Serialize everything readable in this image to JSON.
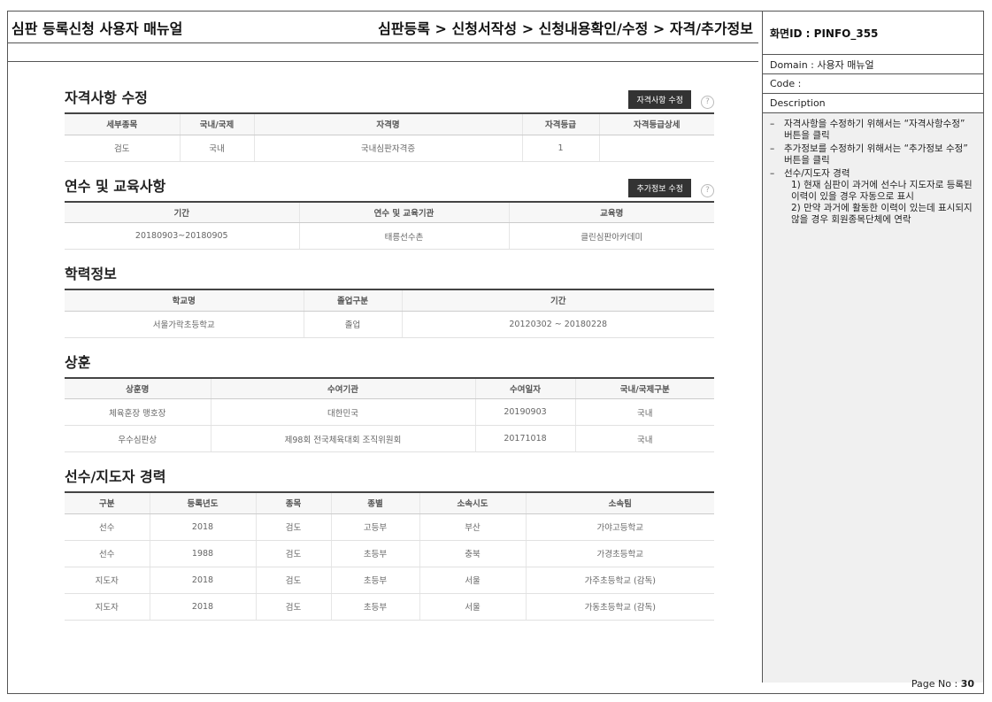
{
  "header": {
    "doc_title": "심판 등록신청 사용자 매뉴얼",
    "path": "심판등록 > 신청서작성 > 신청내용확인/수정 > 자격/추가정보"
  },
  "qualifications": {
    "title": "자격사항 수정",
    "button": "자격사항 수정",
    "help": "?",
    "columns": [
      "세부종목",
      "국내/국제",
      "자격명",
      "자격등급",
      "자격등급상세"
    ],
    "rows": [
      [
        "검도",
        "국내",
        "국내심판자격증",
        "1",
        ""
      ]
    ]
  },
  "training": {
    "title": "연수 및 교육사항",
    "button": "추가정보 수정",
    "help": "?",
    "columns": [
      "기간",
      "연수 및 교육기관",
      "교육명"
    ],
    "rows": [
      [
        "20180903~20180905",
        "태릉선수촌",
        "클린심판아카데미"
      ]
    ]
  },
  "education": {
    "title": "학력정보",
    "columns": [
      "학교명",
      "졸업구분",
      "기간"
    ],
    "rows": [
      [
        "서울가락초등학교",
        "졸업",
        "20120302 ~ 20180228"
      ]
    ]
  },
  "awards": {
    "title": "상훈",
    "columns": [
      "상훈명",
      "수여기관",
      "수여일자",
      "국내/국제구분"
    ],
    "rows": [
      [
        "체육훈장 맹호장",
        "대한민국",
        "20190903",
        "국내"
      ],
      [
        "우수심판상",
        "제98회 전국체육대회 조직위원회",
        "20171018",
        "국내"
      ]
    ]
  },
  "career": {
    "title": "선수/지도자 경력",
    "columns": [
      "구분",
      "등록년도",
      "종목",
      "종별",
      "소속시도",
      "소속팀"
    ],
    "rows": [
      [
        "선수",
        "2018",
        "검도",
        "고등부",
        "부산",
        "가야고등학교"
      ],
      [
        "선수",
        "1988",
        "검도",
        "초등부",
        "충북",
        "가경초등학교"
      ],
      [
        "지도자",
        "2018",
        "검도",
        "초등부",
        "서울",
        "가주초등학교 (감독)"
      ],
      [
        "지도자",
        "2018",
        "검도",
        "초등부",
        "서울",
        "가동초등학교 (감독)"
      ]
    ]
  },
  "side": {
    "screen_id": "화면ID : PINFO_355",
    "domain": "Domain : 사용자 매뉴얼",
    "code": "Code :",
    "description_label": "Description",
    "desc1": "자격사항을 수정하기 위해서는 “자격사항수정” 버튼을 클릭",
    "desc2": "추가정보를 수정하기 위해서는 “추가정보 수정” 버튼을 클릭",
    "desc3_title": "선수/지도자 경력",
    "desc3_line1": "1) 현재 심판이 과거에 선수나 지도자로 등록된 이력이 있을 경우 자동으로 표시",
    "desc3_line2": "2) 만약 과거에 활동한 이력이 있는데 표시되지 않을 경우 회원종목단체에 연락"
  },
  "footer": {
    "page_label": "Page No : ",
    "page_number": "30"
  }
}
